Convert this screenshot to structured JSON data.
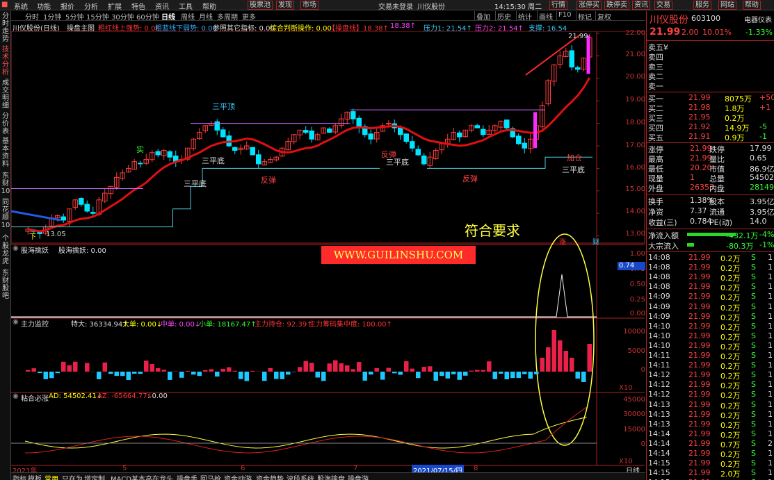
{
  "menu": [
    "系统",
    "功能",
    "报价",
    "分析",
    "扩展",
    "特色",
    "资讯",
    "工具",
    "帮助"
  ],
  "menu_extra": [
    "股票池",
    "发现",
    "市场"
  ],
  "login": "交易未登录",
  "window_title": "川仪股份",
  "clock": "14:15:30 周二",
  "top_buttons": [
    "行情",
    "涨停买",
    "跌停卖",
    "资讯",
    "交易",
    "服务",
    "网站",
    "帮助"
  ],
  "tabs": [
    "分时",
    "1分钟",
    "5分钟",
    "15分钟",
    "30分钟",
    "60分钟",
    "日线",
    "周线",
    "月线",
    "多周期",
    "更多"
  ],
  "toolbtns": [
    "叠加",
    "历史",
    "统计",
    "画线",
    "F10",
    "标记",
    "复权"
  ],
  "left_tabs": [
    "分时走势",
    "技术分析",
    "成交明细",
    "分价表",
    "基本资料",
    "东财10",
    "同花顺10",
    "个股龙虎",
    "东财股吧"
  ],
  "status": {
    "name": "川仪股份(日线)",
    "main": "操盘主图",
    "s1": "粗红线上强势: 0.00",
    "s2": "粗蓝线下弱势: 0.00",
    "s3": "参照其它指标: 0.00",
    "s4": "综合判断操作: 0.00",
    "s5": "【操盘线】18.38↑",
    "s6": "18.38↑",
    "s7": "压力1: 21.54↑",
    "s8": "压力2: 21.54↑",
    "s9": "支撑: 16.54"
  },
  "main_axis": [
    "22.00",
    "21.00",
    "20.00",
    "19.00",
    "18.00",
    "17.00",
    "16.00",
    "15.00",
    "14.00",
    "13.00"
  ],
  "labels": {
    "sanpingding": "三平顶",
    "sanpingdi1": "三平底",
    "sanpingdi2": "三平底",
    "sanpingdi3": "三平底",
    "sanpingdi4": "三平底",
    "fantan1": "反弹",
    "fantan2": "反弹",
    "fantan3": "反弹",
    "jiacang": "加仓",
    "shi": "实",
    "low": "13.05",
    "high": "21.99",
    "xiaji": "下"
  },
  "annotation": "符合要求",
  "watermark": "WWW.GUILINSHU.COM",
  "pane2": {
    "title": "股海擒妖",
    "t2": "股海擒妖: 0.00",
    "axis": [
      "1.00",
      "0.75",
      "0.50",
      "0.25",
      "0.00"
    ],
    "marker": "0.74"
  },
  "pane3": {
    "title": "主力监控",
    "t1": "特大: 36334.94↑",
    "t2": "大单: 0.00↓",
    "t3": "中单: 0.00↓",
    "t4": "小单: 18167.47↑",
    "t5": "主力持仓: 92.39↑",
    "t6": "主力筹码集中度: 100.00↑",
    "axis": [
      "10000",
      "5000",
      "0"
    ],
    "unit": "X10"
  },
  "pane4": {
    "title": "粘合必涨",
    "t1": "AD: 54502.41↓",
    "t2": "AZ: -65664.77↓",
    "t3": ": 0.00",
    "axis": [
      "45000",
      "30000",
      "15000",
      "0"
    ],
    "unit": "X10"
  },
  "dates": {
    "d1": "2021年",
    "d2": "5",
    "d3": "6",
    "d4": "7",
    "d5": "2021/07/15/四",
    "d6": "8",
    "d7": "日线"
  },
  "bottom_tabs": [
    "指标",
    "模板",
    "常用",
    "只在为",
    "增定制",
    "MACD某本",
    "高在龙头",
    "操盘手",
    "回马枪",
    "资金动游",
    "资金趋势",
    "波段系统",
    "股海擒盘",
    "操盘游"
  ],
  "chips": {
    "zhang": "涨",
    "cai": "财"
  },
  "quote": {
    "name": "川仪股份",
    "code": "603100",
    "price": "21.99",
    "chg": "2.00",
    "pct": "10.01%",
    "box": "电器仪表",
    "box_pct": "-1.33%"
  },
  "asks": [
    {
      "l": "卖五",
      "p": "",
      "v": "",
      "d": ""
    },
    {
      "l": "卖四",
      "p": "",
      "v": "",
      "d": ""
    },
    {
      "l": "卖三",
      "p": "",
      "v": "",
      "d": ""
    },
    {
      "l": "卖二",
      "p": "",
      "v": "",
      "d": ""
    },
    {
      "l": "卖一",
      "p": "",
      "v": "",
      "d": ""
    }
  ],
  "ask_mark": "¥",
  "bids": [
    {
      "l": "买一",
      "p": "21.99",
      "v": "8075万",
      "d": "+50"
    },
    {
      "l": "买二",
      "p": "21.98",
      "v": "1.8万",
      "d": "+1"
    },
    {
      "l": "买三",
      "p": "21.95",
      "v": "0.2万",
      "d": ""
    },
    {
      "l": "买四",
      "p": "21.92",
      "v": "14.9万",
      "d": "-5"
    },
    {
      "l": "买五",
      "p": "21.91",
      "v": "0.9万",
      "d": "-1"
    }
  ],
  "stats": [
    [
      "涨停",
      "21.99",
      "跌停",
      "17.99"
    ],
    [
      "最高",
      "21.99",
      "量比",
      "0.65"
    ],
    [
      "最低",
      "20.20",
      "市值",
      "86.9亿"
    ],
    [
      "现量",
      "1",
      "总量",
      "54502"
    ],
    [
      "外盘",
      "26353",
      "内盘",
      "28149"
    ]
  ],
  "stats2": [
    [
      "换手",
      "1.38%",
      "股本",
      "3.95亿"
    ],
    [
      "净资",
      "7.37",
      "流通",
      "3.95亿"
    ],
    [
      "收益(三)",
      "0.784",
      "PE(动)",
      "14.0"
    ]
  ],
  "flows": [
    {
      "l": "净流入额",
      "v": "-432.1万",
      "p": "-4%"
    },
    {
      "l": "大宗流入",
      "v": "-80.3万",
      "p": "-1%"
    }
  ],
  "ticks": [
    [
      "14:08",
      "21.99",
      "0.2万",
      "S",
      "1"
    ],
    [
      "14:08",
      "21.99",
      "0.2万",
      "S",
      "1"
    ],
    [
      "14:08",
      "21.99",
      "0.2万",
      "S",
      "1"
    ],
    [
      "14:08",
      "21.99",
      "0.2万",
      "S",
      "1"
    ],
    [
      "14:09",
      "21.99",
      "0.2万",
      "S",
      "1"
    ],
    [
      "14:09",
      "21.99",
      "0.2万",
      "S",
      "1"
    ],
    [
      "14:09",
      "21.99",
      "0.2万",
      "S",
      "1"
    ],
    [
      "14:10",
      "21.99",
      "0.2万",
      "S",
      "1"
    ],
    [
      "14:10",
      "21.99",
      "0.2万",
      "S",
      "1"
    ],
    [
      "14:10",
      "21.99",
      "0.2万",
      "S",
      "1"
    ],
    [
      "14:11",
      "21.99",
      "0.2万",
      "S",
      "1"
    ],
    [
      "14:11",
      "21.99",
      "0.2万",
      "S",
      "1"
    ],
    [
      "14:12",
      "21.99",
      "0.2万",
      "S",
      "1"
    ],
    [
      "14:12",
      "21.99",
      "0.2万",
      "S",
      "1"
    ],
    [
      "14:12",
      "21.99",
      "0.2万",
      "S",
      "1"
    ],
    [
      "14:13",
      "21.99",
      "0.2万",
      "S",
      "1"
    ],
    [
      "14:13",
      "21.99",
      "0.2万",
      "S",
      "1"
    ],
    [
      "14:13",
      "21.99",
      "0.2万",
      "S",
      "1"
    ],
    [
      "14:14",
      "21.99",
      "0.2万",
      "S",
      "1"
    ],
    [
      "14:14",
      "21.99",
      "0.7万",
      "S",
      "2"
    ],
    [
      "14:14",
      "21.99",
      "0.2万",
      "S",
      "1"
    ],
    [
      "14:15",
      "21.99",
      "0.2万",
      "S",
      "1"
    ],
    [
      "14:15",
      "21.99",
      "2.0万",
      "S",
      "1"
    ],
    [
      "14:15",
      "21.99",
      "0.2万",
      "S",
      "1"
    ]
  ],
  "colors": {
    "up": "#ff3b3b",
    "down": "#00e5ff",
    "ma_red": "#e01010",
    "ma_blue": "#1e5ee8",
    "yellow": "#ffff40"
  }
}
